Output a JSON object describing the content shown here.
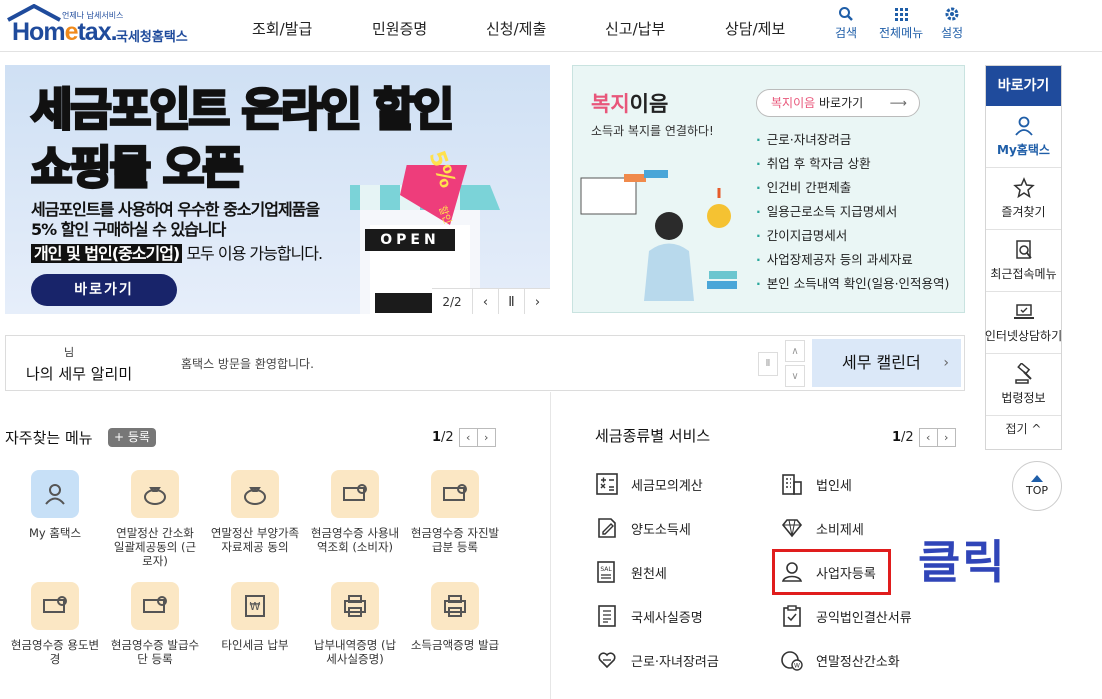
{
  "header": {
    "logo_text_a": "Hom",
    "logo_text_b": "e",
    "logo_text_c": "tax.",
    "logo_sub": "언제나 납세서비스",
    "logo_kor": "국세청홈택스",
    "menu": [
      "조회/발급",
      "민원증명",
      "신청/제출",
      "신고/납부",
      "상담/제보"
    ],
    "utils": [
      {
        "label": "검색",
        "icon": "search-icon"
      },
      {
        "label": "전체메뉴",
        "icon": "grid-icon"
      },
      {
        "label": "설정",
        "icon": "gear-icon"
      }
    ]
  },
  "banner": {
    "title1": "세금포인트 온라인 할인",
    "title2": "쇼핑몰 오픈",
    "desc1": "세금포인트를 사용하여 우수한 중소기업제품을",
    "desc2": "5% 할인 구매하실 수 있습니다",
    "desc3a": "개인 및 법인(중소기업)",
    "desc3b": " 모두 이용 가능합니다.",
    "button": "바로가기",
    "tag": "5%",
    "tag_sub": "할인",
    "open": "OPEN",
    "page": "2/2"
  },
  "welfare": {
    "title_a": "복지",
    "title_b": "이음",
    "subtitle": "소득과 복지를 연결하다!",
    "btn_a": "복지이음",
    "btn_b": " 바로가기",
    "items": [
      "근로·자녀장려금",
      "취업 후 학자금 상환",
      "인건비 간편제출",
      "일용근로소득 지급명세서",
      "간이지급명세서",
      "사업장제공자 등의 과세자료",
      "본인 소득내역 확인(일용·인적용역)"
    ]
  },
  "quick": {
    "title": "바로가기",
    "items": [
      {
        "label": "My홈택스",
        "icon": "user-icon"
      },
      {
        "label": "즐겨찾기",
        "icon": "star-icon"
      },
      {
        "label": "최근접속메뉴",
        "icon": "recent-icon"
      },
      {
        "label": "인터넷상담하기",
        "icon": "laptop-icon"
      },
      {
        "label": "법령정보",
        "icon": "gavel-icon"
      }
    ],
    "fold": "접기 ^",
    "top": "TOP"
  },
  "notice": {
    "suffix": "님",
    "title": "나의 세무 알리미",
    "message": "홈택스 방문을 환영합니다.",
    "calendar": "세무 캘린더"
  },
  "favorites": {
    "title": "자주찾는 메뉴",
    "register": "+ 등록",
    "page_cur": "1",
    "page_total": "/2",
    "items": [
      {
        "label": "My 홈택스"
      },
      {
        "label": "연말정산 간소화 일괄제공동의 (근로자)"
      },
      {
        "label": "연말정산 부양가족 자료제공 동의"
      },
      {
        "label": "현금영수증 사용내역조회 (소비자)"
      },
      {
        "label": "현금영수증 자진발급분 등록"
      },
      {
        "label": "현금영수증 용도변경"
      },
      {
        "label": "현금영수증 발급수단 등록"
      },
      {
        "label": "타인세금 납부"
      },
      {
        "label": "납부내역증명 (납세사실증명)"
      },
      {
        "label": "소득금액증명 발급"
      }
    ]
  },
  "services": {
    "title": "세금종류별 서비스",
    "page_cur": "1",
    "page_total": "/2",
    "items": [
      {
        "label": "세금모의계산",
        "icon": "calculator-icon"
      },
      {
        "label": "법인세",
        "icon": "building-icon"
      },
      {
        "label": "양도소득세",
        "icon": "document-pen-icon"
      },
      {
        "label": "소비제세",
        "icon": "diamond-icon"
      },
      {
        "label": "원천세",
        "icon": "salary-icon"
      },
      {
        "label": "사업자등록",
        "icon": "person-icon"
      },
      {
        "label": "국세사실증명",
        "icon": "certificate-icon"
      },
      {
        "label": "공익법인결산서류",
        "icon": "clipboard-icon"
      },
      {
        "label": "근로·자녀장려금",
        "icon": "heart-hand-icon"
      },
      {
        "label": "연말정산간소화",
        "icon": "coin-icon"
      }
    ]
  },
  "annotation": {
    "text": "클릭",
    "color": "#e01d1d"
  }
}
